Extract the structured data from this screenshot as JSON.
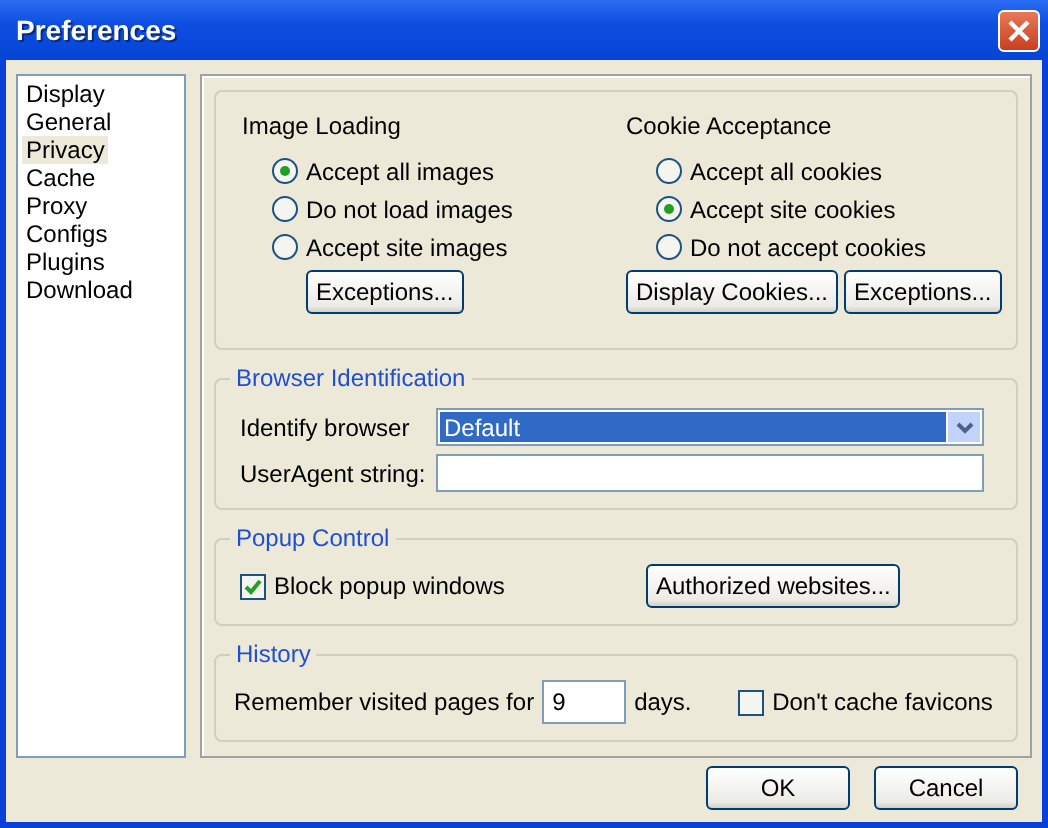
{
  "window": {
    "title": "Preferences"
  },
  "sidebar": {
    "items": [
      {
        "label": "Display",
        "selected": false
      },
      {
        "label": "General",
        "selected": false
      },
      {
        "label": "Privacy",
        "selected": true
      },
      {
        "label": "Cache",
        "selected": false
      },
      {
        "label": "Proxy",
        "selected": false
      },
      {
        "label": "Configs",
        "selected": false
      },
      {
        "label": "Plugins",
        "selected": false
      },
      {
        "label": "Download",
        "selected": false
      }
    ]
  },
  "image_loading": {
    "title": "Image Loading",
    "options": [
      {
        "label": "Accept all images",
        "selected": true
      },
      {
        "label": "Do not load images",
        "selected": false
      },
      {
        "label": "Accept site images",
        "selected": false
      }
    ],
    "buttons": [
      "Exceptions..."
    ]
  },
  "cookie_acceptance": {
    "title": "Cookie Acceptance",
    "options": [
      {
        "label": "Accept all cookies",
        "selected": false
      },
      {
        "label": "Accept site cookies",
        "selected": true
      },
      {
        "label": "Do not accept cookies",
        "selected": false
      }
    ],
    "buttons": [
      "Display Cookies...",
      "Exceptions..."
    ]
  },
  "browser_identification": {
    "title": "Browser Identification",
    "identify_label": "Identify browser",
    "identify_value": "Default",
    "useragent_label": "UserAgent string:"
  },
  "popup_control": {
    "title": "Popup Control",
    "checkbox": {
      "label": "Block popup windows",
      "checked": true
    },
    "button": "Authorized websites..."
  },
  "history": {
    "title": "History",
    "label_before": "Remember visited pages for",
    "days": "9",
    "label_after": "days.",
    "favicons": {
      "label": "Don't cache favicons",
      "checked": false
    }
  },
  "buttons": [
    "OK",
    "Cancel"
  ]
}
